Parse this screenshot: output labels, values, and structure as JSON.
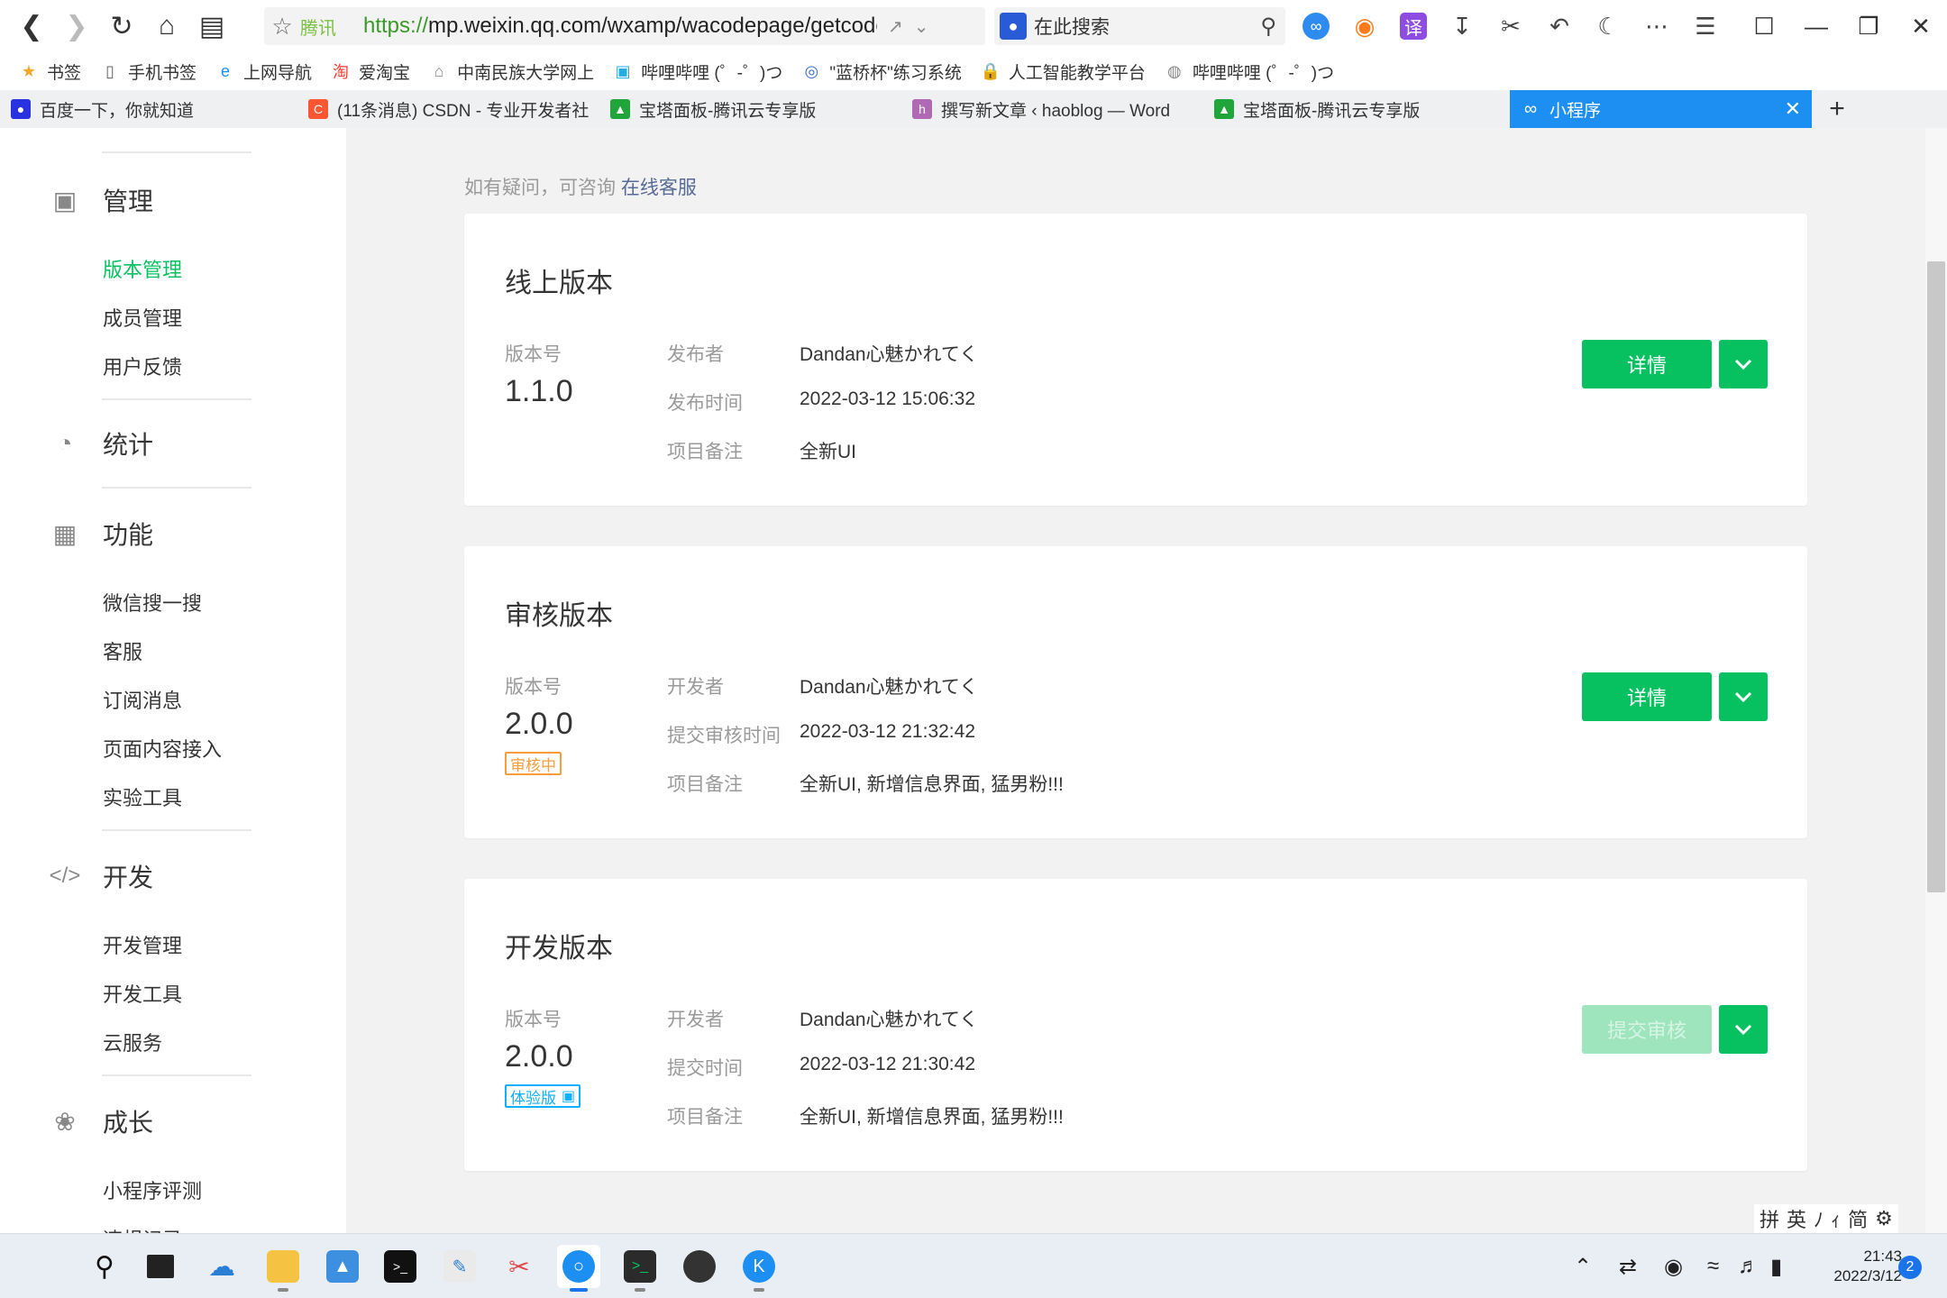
{
  "browser": {
    "address": {
      "site": "腾讯",
      "url_scheme": "https://",
      "url_rest": "mp.weixin.qq.com/wxamp/wacodepage/getcodepage"
    },
    "search_placeholder": "在此搜索",
    "bookmarks": [
      {
        "label": "书签",
        "icon": "star-icon",
        "color": "#f5a623"
      },
      {
        "label": "手机书签",
        "icon": "phone-icon",
        "color": "#666"
      },
      {
        "label": "上网导航",
        "icon": "ie-icon",
        "color": "#1e8ff2"
      },
      {
        "label": "爱淘宝",
        "icon": "taobao-icon",
        "color": "#ff3b30"
      },
      {
        "label": "中南民族大学网上",
        "icon": "home-icon",
        "color": "#888"
      },
      {
        "label": "哔哩哔哩 (゜-゜)つ",
        "icon": "bilibili-icon",
        "color": "#23ade5"
      },
      {
        "label": "\"蓝桥杯\"练习系统",
        "icon": "lanqiao-icon",
        "color": "#3b6ec9"
      },
      {
        "label": "人工智能教学平台",
        "icon": "lock-icon",
        "color": "#1eb3e8"
      },
      {
        "label": "哔哩哔哩 (゜-゜)つ",
        "icon": "globe-icon",
        "color": "#888"
      }
    ],
    "tabs": [
      {
        "label": "百度一下，你就知道",
        "icon": "baidu-icon",
        "color": "#2932e1"
      },
      {
        "label": "(11条消息) CSDN - 专业开发者社",
        "icon": "csdn-icon",
        "color": "#fc5531"
      },
      {
        "label": "宝塔面板-腾讯云专享版",
        "icon": "bt-icon",
        "color": "#20a53a"
      },
      {
        "label": "撰写新文章 ‹ haoblog — Word",
        "icon": "wp-icon",
        "color": "#b06ab3"
      },
      {
        "label": "宝塔面板-腾讯云专享版",
        "icon": "bt-icon",
        "color": "#20a53a"
      },
      {
        "label": "小程序",
        "icon": "miniprogram-icon",
        "color": "#ffffff"
      }
    ]
  },
  "sidebar": {
    "sections": [
      {
        "label": "管理",
        "icon": "inbox-icon",
        "items": [
          "版本管理",
          "成员管理",
          "用户反馈"
        ]
      },
      {
        "label": "统计",
        "icon": "pie-chart-icon",
        "items": []
      },
      {
        "label": "功能",
        "icon": "grid-icon",
        "items": [
          "微信搜一搜",
          "客服",
          "订阅消息",
          "页面内容接入",
          "实验工具"
        ]
      },
      {
        "label": "开发",
        "icon": "code-icon",
        "items": [
          "开发管理",
          "开发工具",
          "云服务"
        ]
      },
      {
        "label": "成长",
        "icon": "sprout-icon",
        "items": [
          "小程序评测",
          "违规记录"
        ]
      }
    ],
    "active_item": "版本管理"
  },
  "main": {
    "help_text": "如有疑问，可咨询",
    "help_link": "在线客服",
    "cards": [
      {
        "title": "线上版本",
        "version_label": "版本号",
        "version": "1.1.0",
        "tag": "",
        "rows": [
          {
            "key": "发布者",
            "value": "Dandan心魅かれてく"
          },
          {
            "key": "发布时间",
            "value": "2022-03-12 15:06:32"
          },
          {
            "key": "项目备注",
            "value": "全新UI"
          }
        ],
        "button": "详情",
        "button_disabled": false
      },
      {
        "title": "审核版本",
        "version_label": "版本号",
        "version": "2.0.0",
        "tag": "审核中",
        "rows": [
          {
            "key": "开发者",
            "value": "Dandan心魅かれてく"
          },
          {
            "key": "提交审核时间",
            "value": "2022-03-12 21:32:42"
          },
          {
            "key": "项目备注",
            "value": "全新UI, 新增信息界面, 猛男粉!!!"
          }
        ],
        "button": "详情",
        "button_disabled": false
      },
      {
        "title": "开发版本",
        "version_label": "版本号",
        "version": "2.0.0",
        "tag": "体验版",
        "rows": [
          {
            "key": "开发者",
            "value": "Dandan心魅かれてく"
          },
          {
            "key": "提交时间",
            "value": "2022-03-12 21:30:42"
          },
          {
            "key": "项目备注",
            "value": "全新UI, 新增信息界面, 猛男粉!!!"
          }
        ],
        "button": "提交审核",
        "button_disabled": true
      }
    ]
  },
  "ime": {
    "mode": "拼",
    "items": [
      "英",
      "ﾉ",
      "ｨ",
      "简",
      "⚙"
    ]
  },
  "taskbar": {
    "time": "21:43",
    "date": "2022/3/12",
    "notifications": "2"
  },
  "colors": {
    "accent": "#07c160",
    "accent_disabled": "#9ee4bd",
    "tag_review": "#fa9d3b",
    "tag_trial": "#10aeff",
    "link": "#576b95"
  }
}
